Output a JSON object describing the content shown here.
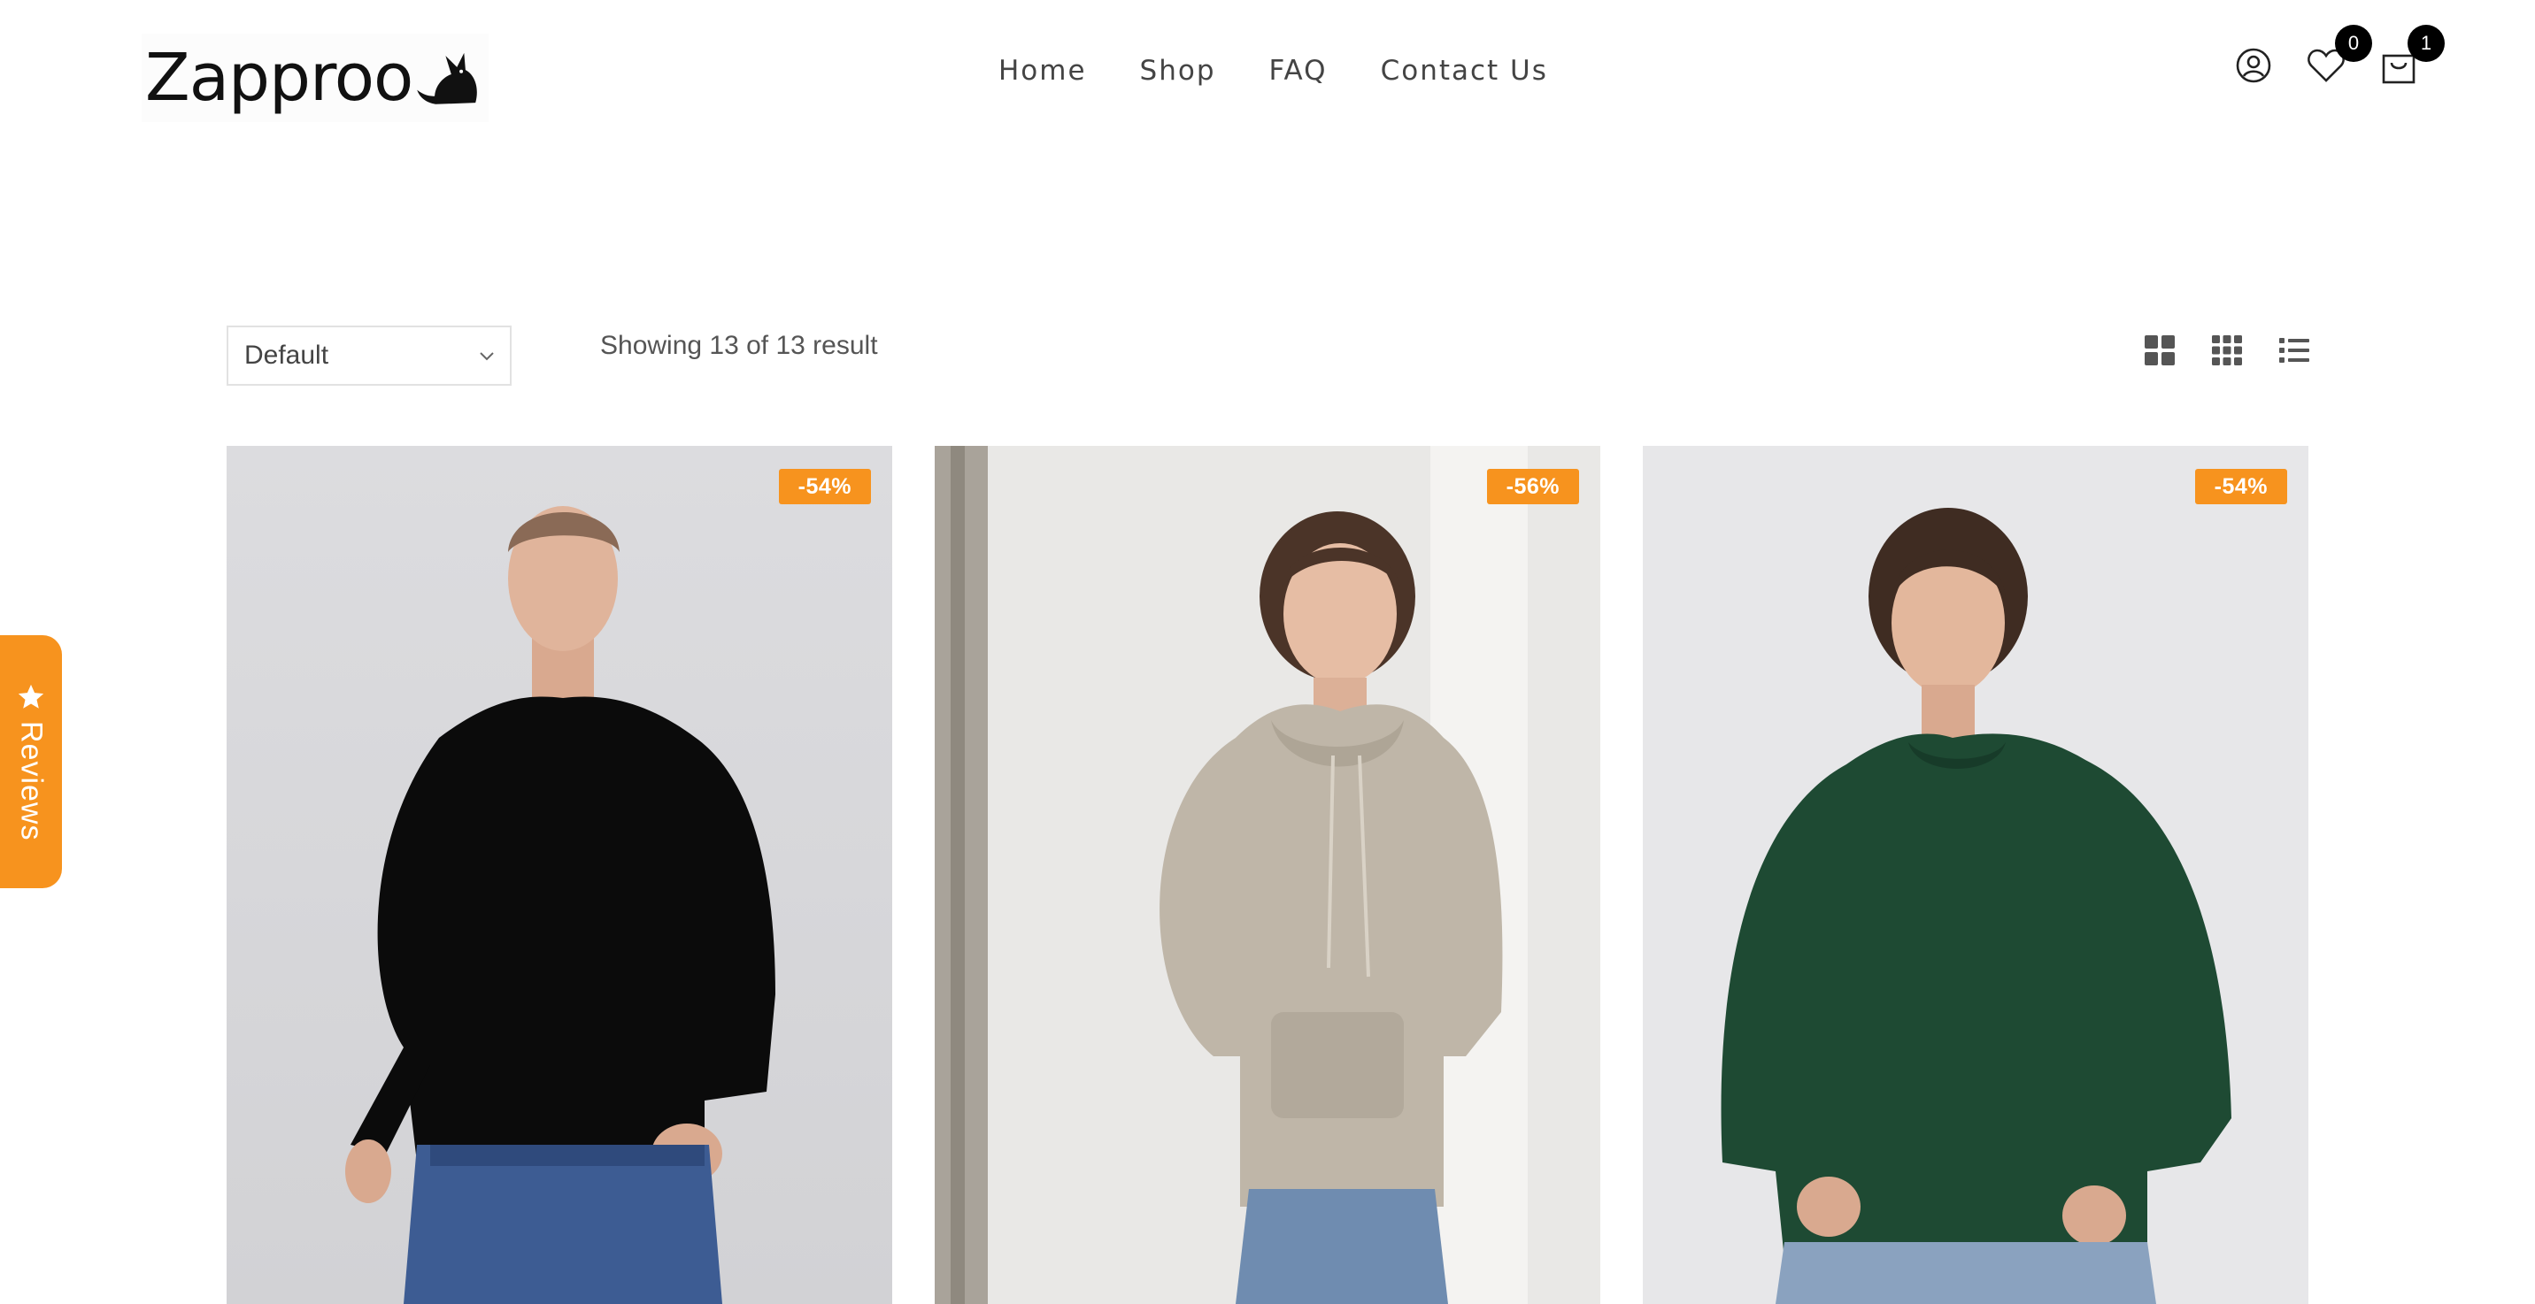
{
  "brand": {
    "name": "Zapproo"
  },
  "nav": {
    "items": [
      {
        "label": "Home"
      },
      {
        "label": "Shop"
      },
      {
        "label": "FAQ"
      },
      {
        "label": "Contact Us"
      }
    ]
  },
  "header_icons": {
    "account_icon": "user-circle-icon",
    "wishlist_icon": "heart-icon",
    "wishlist_count": "0",
    "cart_icon": "shopping-bag-icon",
    "cart_count": "1"
  },
  "toolbar": {
    "sort_selected": "Default",
    "result_text": "Showing 13 of 13 result",
    "view_icons": [
      "grid-2-icon",
      "grid-3-icon",
      "list-icon"
    ]
  },
  "reviews_tab": {
    "label": "Reviews",
    "icon": "star-icon",
    "color": "#f7931e"
  },
  "products": [
    {
      "discount": "-54%",
      "garment_color": "#0b0b0b"
    },
    {
      "discount": "-56%",
      "garment_color": "#bfb6a8"
    },
    {
      "discount": "-54%",
      "garment_color": "#1e4a33"
    }
  ],
  "colors": {
    "accent": "#f7931e",
    "text": "#444444"
  }
}
